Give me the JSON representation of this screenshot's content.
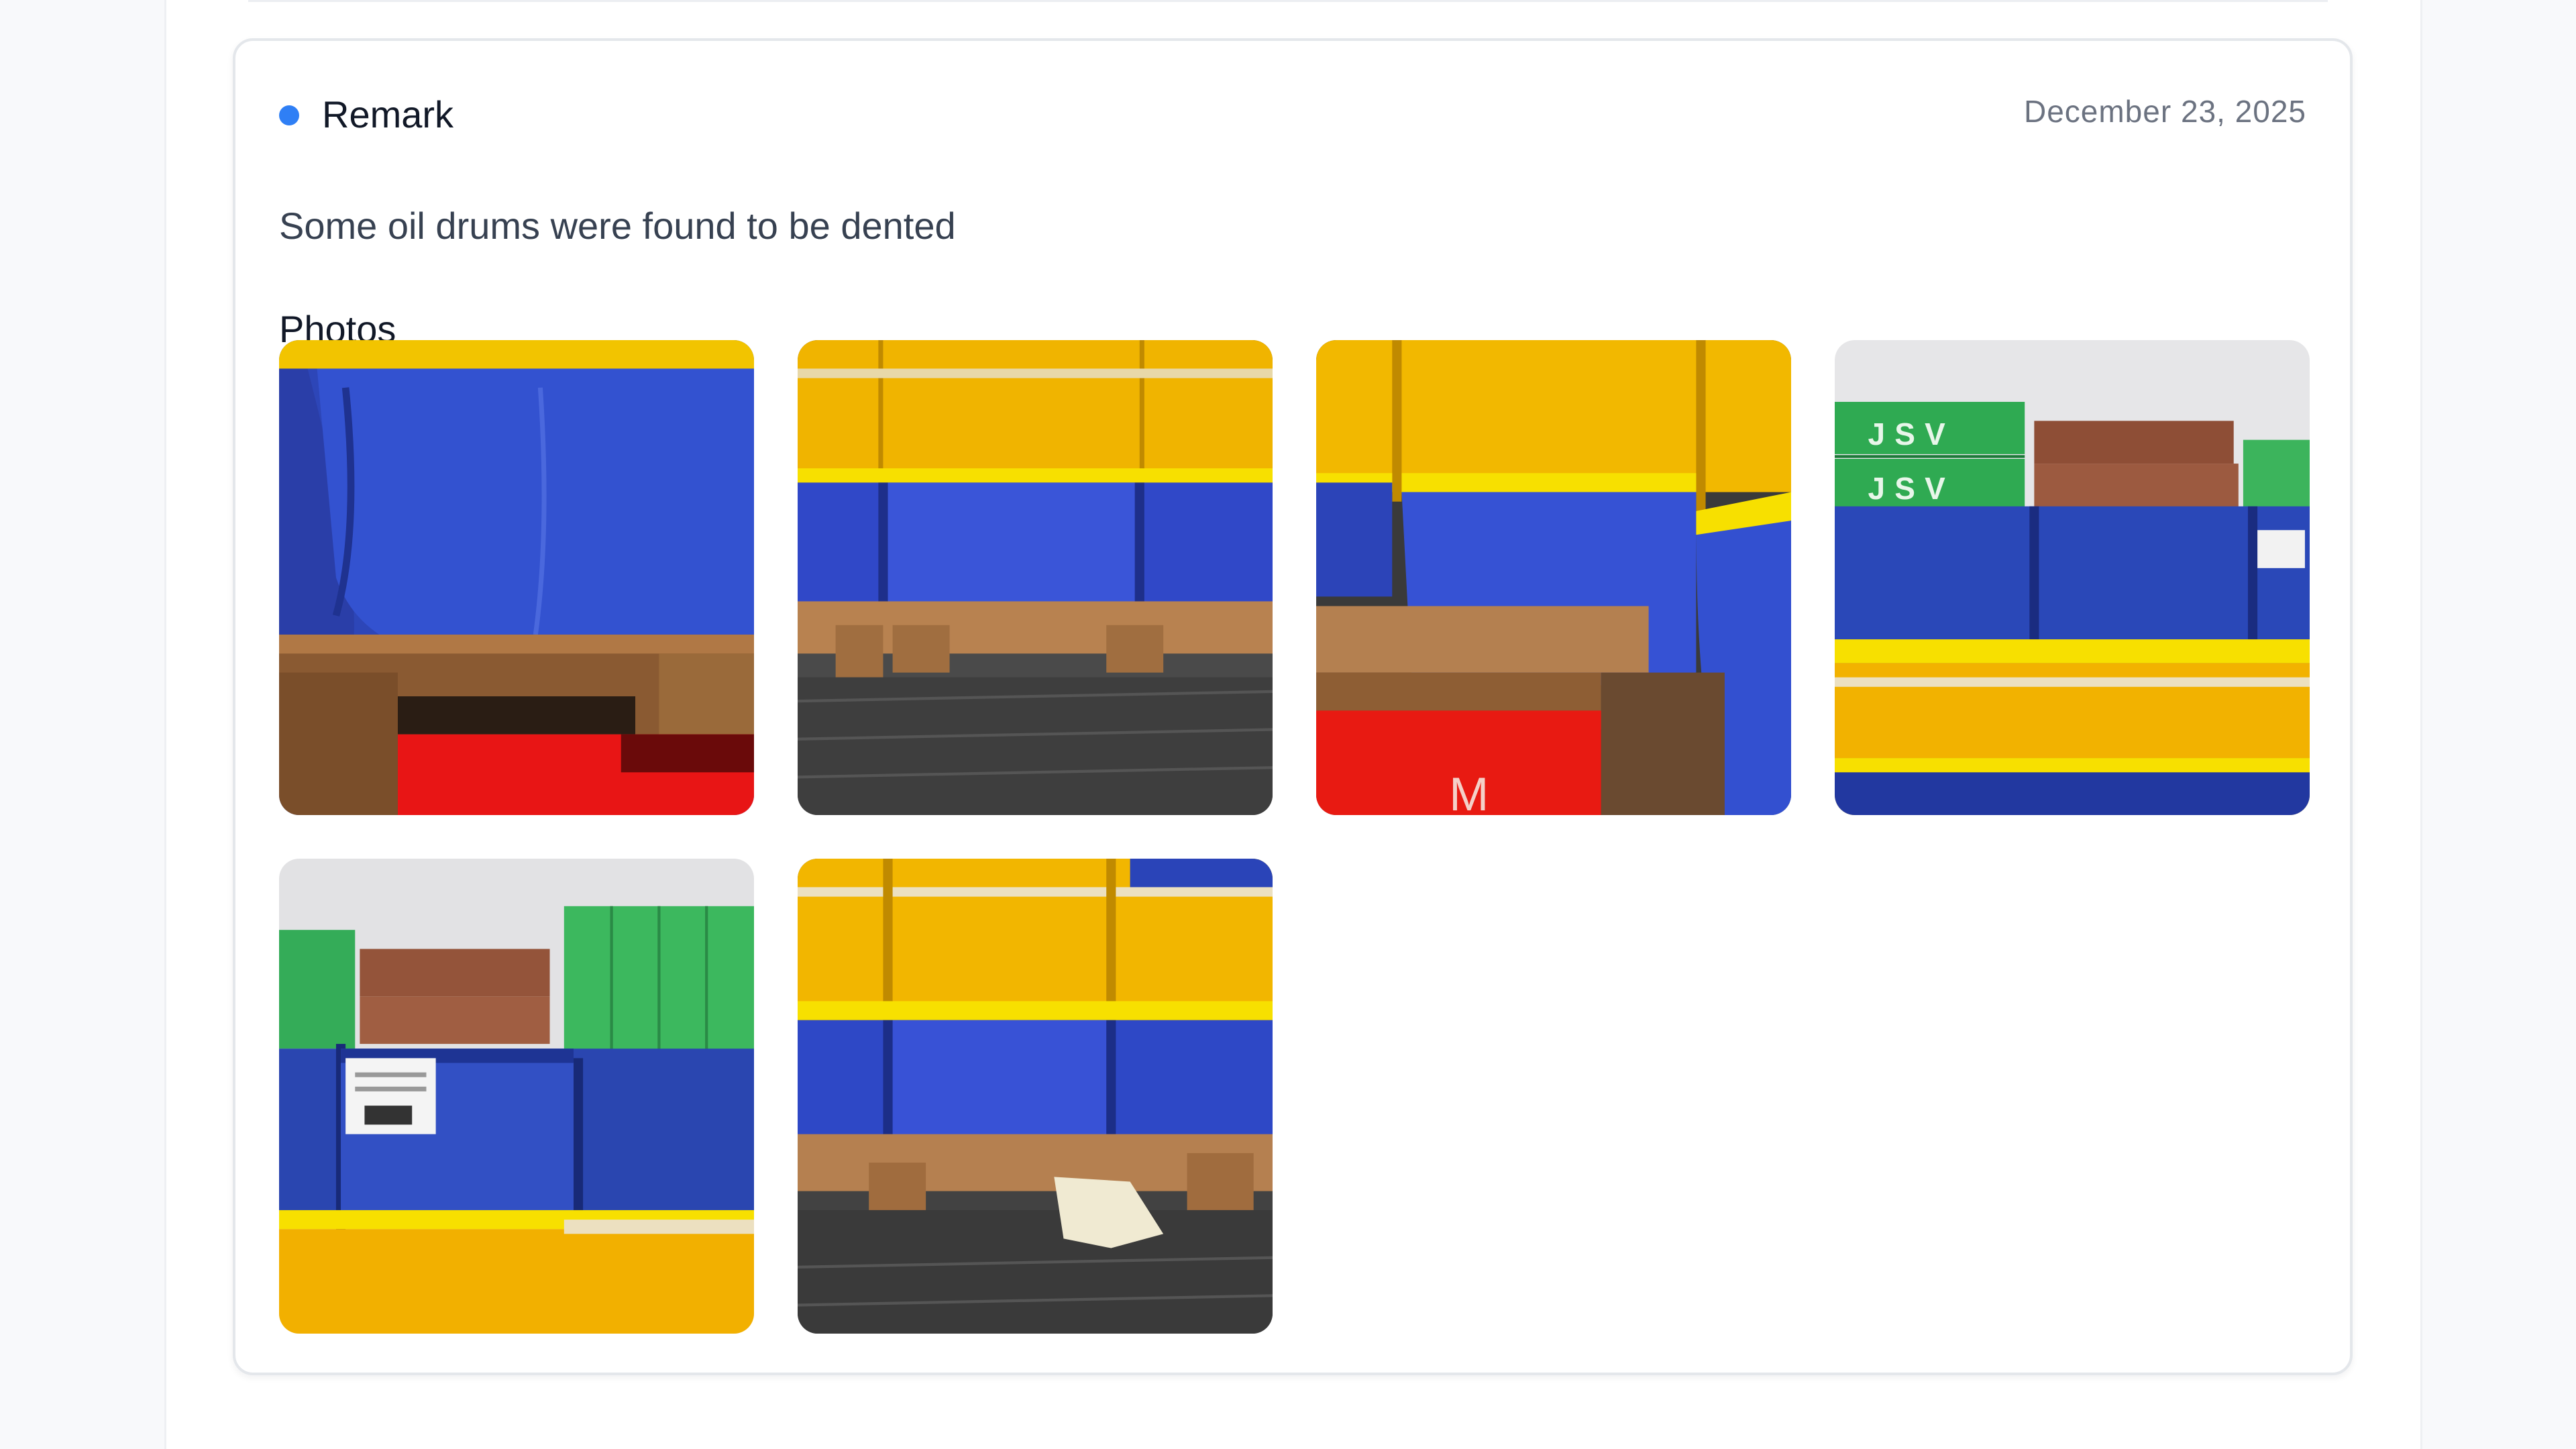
{
  "remark": {
    "label": "Remark",
    "status_color": "#2f7ff5",
    "date": "December 23, 2025",
    "description": "Some oil drums were found to be dented"
  },
  "photos": {
    "heading": "Photos",
    "items": [
      {
        "subject": "dented blue drum on wooden pallet, red deck"
      },
      {
        "subject": "yellow-blue drums on pallets, dark floor"
      },
      {
        "subject": "yellow-blue drum close-up on pallet, red deck"
      },
      {
        "subject": "stacked drums in front of shipping containers",
        "container_marking": "JSV"
      },
      {
        "subject": "labelled drums in front of shipping containers"
      },
      {
        "subject": "drums on pallets with absorbent pad on floor"
      }
    ]
  }
}
